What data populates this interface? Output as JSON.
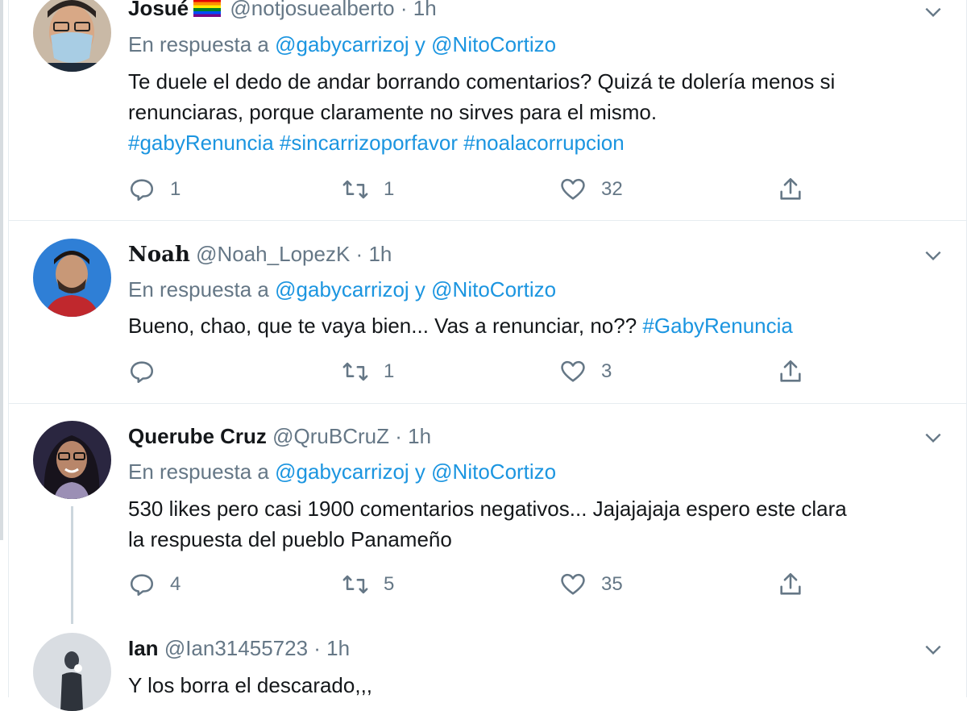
{
  "reply_prefix": "En respuesta a",
  "tweets": [
    {
      "name": "Josué",
      "handle": "@notjosuealberto",
      "sep": "·",
      "time": "1h",
      "reply_to_1": "@gabycarrizoj",
      "reply_and": "y",
      "reply_to_2": "@NitoCortizo",
      "text_line1": "Te duele el dedo de andar borrando comentarios? Quizá te dolería menos si",
      "text_line2": "renunciaras, porque claramente no sirves para el mismo.",
      "hashtags": "#gabyRenuncia #sincarrizoporfavor #noalacorrupcion",
      "replies": "1",
      "retweets": "1",
      "likes": "32"
    },
    {
      "name": "𝐍𝐨𝐚𝐡",
      "handle": "@Noah_LopezK",
      "sep": "·",
      "time": "1h",
      "reply_to_1": "@gabycarrizoj",
      "reply_and": "y",
      "reply_to_2": "@NitoCortizo",
      "text_line1": "Bueno, chao, que te vaya bien... Vas a renunciar, no?? ",
      "hashtag": "#GabyRenuncia",
      "replies": "",
      "retweets": "1",
      "likes": "3"
    },
    {
      "name": "Querube Cruz",
      "handle": "@QruBCruZ",
      "sep": "·",
      "time": "1h",
      "reply_to_1": "@gabycarrizoj",
      "reply_and": "y",
      "reply_to_2": "@NitoCortizo",
      "text_line1": "530 likes pero casi 1900 comentarios negativos... Jajajajaja espero este clara",
      "text_line2": "la respuesta del pueblo Panameño",
      "replies": "4",
      "retweets": "5",
      "likes": "35"
    },
    {
      "name": "Ian",
      "handle": "@Ian31455723",
      "sep": "·",
      "time": "1h",
      "text_line1": "Y los borra el descarado,,,"
    }
  ],
  "colors": {
    "link": "#1b95e0",
    "muted": "#657786",
    "text": "#14171a",
    "border": "#e6ecf0"
  }
}
